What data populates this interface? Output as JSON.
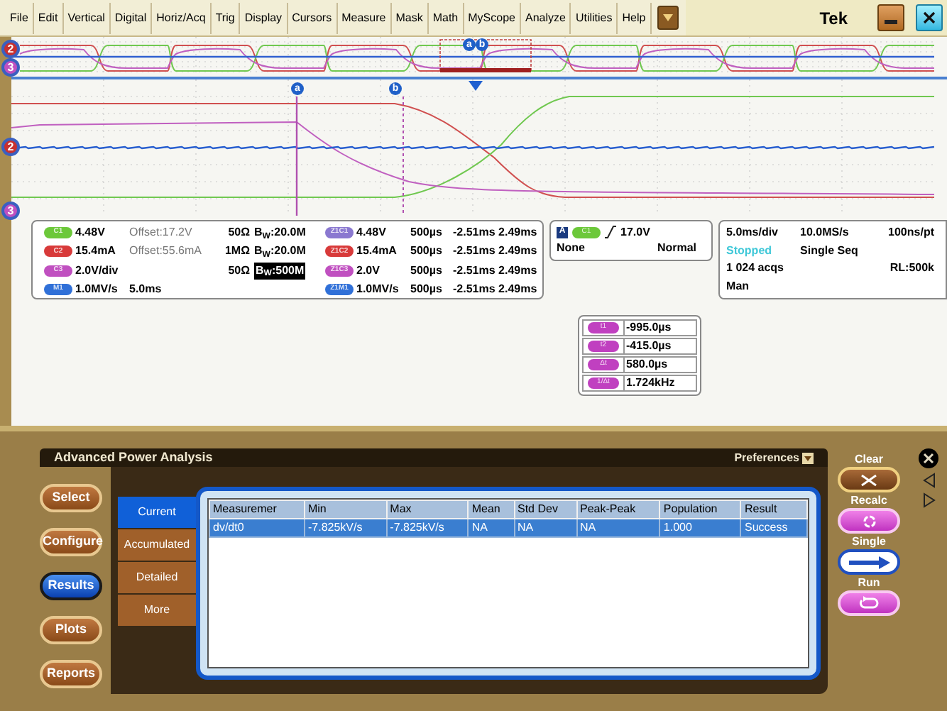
{
  "menu": [
    {
      "label": "File"
    },
    {
      "label": "Edit"
    },
    {
      "label": "Vertical"
    },
    {
      "label": "Digital"
    },
    {
      "label": "Horiz/Acq"
    },
    {
      "label": "Trig"
    },
    {
      "label": "Display"
    },
    {
      "label": "Cursors"
    },
    {
      "label": "Measure"
    },
    {
      "label": "Mask"
    },
    {
      "label": "Math"
    },
    {
      "label": "MyScope"
    },
    {
      "label": "Analyze"
    },
    {
      "label": "Utilities"
    },
    {
      "label": "Help"
    }
  ],
  "logo": "Tek",
  "display": {
    "overview_markers": [
      {
        "label": "2",
        "color": "#c83030"
      },
      {
        "label": "3",
        "color": "#c050c0"
      }
    ],
    "overview_cursors": [
      {
        "label": "a"
      },
      {
        "label": "b"
      }
    ],
    "main_markers": [
      {
        "label": "2",
        "color": "#c83030"
      },
      {
        "label": "3",
        "color": "#c050c0"
      }
    ],
    "main_cursors": [
      {
        "label": "a"
      },
      {
        "label": "b"
      }
    ]
  },
  "readouts": [
    {
      "badge": "C1",
      "color": "#6cc83a",
      "value": "4.48V",
      "detail": "Offset:17.2V",
      "impedance": "50Ω",
      "bandwidth": "B$_{W}$:20.0M",
      "bandwidth_highlighted": false,
      "zoom": {
        "badge": "Z1C1",
        "color": "#8a78d0",
        "value": "4.48V",
        "time": "500µs",
        "range": "-2.51ms 2.49ms"
      }
    },
    {
      "badge": "C2",
      "color": "#d83a3a",
      "value": "15.4mA",
      "detail": "Offset:55.6mA",
      "impedance": "1MΩ",
      "bandwidth": "B$_{W}$:20.0M",
      "bandwidth_highlighted": false,
      "zoom": {
        "badge": "Z1C2",
        "color": "#d83a3a",
        "value": "15.4mA",
        "time": "500µs",
        "range": "-2.51ms 2.49ms"
      }
    },
    {
      "badge": "C3",
      "color": "#c050c0",
      "value": "2.0V/div",
      "impedance": "50Ω",
      "bandwidth": "B$_{W}$:500M",
      "bandwidth_highlighted": true,
      "zoom": {
        "badge": "Z1C3",
        "color": "#c050c0",
        "value": "2.0V",
        "time": "500µs",
        "range": "-2.51ms 2.49ms"
      }
    },
    {
      "badge": "M1",
      "color": "#3070d8",
      "value": "1.0MV/s",
      "detail": "5.0ms",
      "zoom": {
        "badge": "Z1M1",
        "color": "#3070d8",
        "value": "1.0MV/s",
        "time": "500µs",
        "range": "-2.51ms 2.49ms"
      }
    }
  ],
  "trigger": {
    "badge": "A",
    "source": "C1",
    "level": "17.0V",
    "coupling": "None",
    "mode": "Normal"
  },
  "acquisition": {
    "scale": "5.0ms/div",
    "rate": "10.0MS/s",
    "resolution": "100ns/pt",
    "state": "Stopped",
    "mode": "Single Seq",
    "count": "1 024 acqs",
    "record_length": "RL:500k",
    "trigger_mode": "Man"
  },
  "cursor_readout": [
    {
      "badge": "t1",
      "value": "-995.0µs"
    },
    {
      "badge": "t2",
      "value": "-415.0µs"
    },
    {
      "badge": "Δt",
      "value": "580.0µs"
    },
    {
      "badge": "1/Δt",
      "value": "1.724kHz"
    }
  ],
  "analysis": {
    "title": "Advanced Power Analysis",
    "preferences": "Preferences",
    "side_buttons": [
      {
        "label": "Select",
        "selected": false
      },
      {
        "label": "Configure",
        "selected": false
      },
      {
        "label": "Results",
        "selected": true
      },
      {
        "label": "Plots",
        "selected": false
      },
      {
        "label": "Reports",
        "selected": false
      }
    ],
    "tabs": [
      {
        "label": "Current",
        "selected": true
      },
      {
        "label": "Accumulated",
        "selected": false
      },
      {
        "label": "Detailed",
        "selected": false
      },
      {
        "label": "More",
        "selected": false
      }
    ],
    "table": {
      "columns": [
        "Measuremer",
        "Min",
        "Max",
        "Mean",
        "Std Dev",
        "Peak-Peak",
        "Population",
        "Result"
      ],
      "rows": [
        {
          "selected": true,
          "cells": [
            "dv/dt0",
            "-7.825kV/s",
            "-7.825kV/s",
            "NA",
            "NA",
            "NA",
            "1.000",
            "Success"
          ]
        }
      ]
    },
    "controls": [
      {
        "label": "Clear",
        "kind": "clear"
      },
      {
        "label": "Recalc",
        "kind": "recalc"
      },
      {
        "label": "Single",
        "kind": "single"
      },
      {
        "label": "Run",
        "kind": "run"
      }
    ]
  }
}
